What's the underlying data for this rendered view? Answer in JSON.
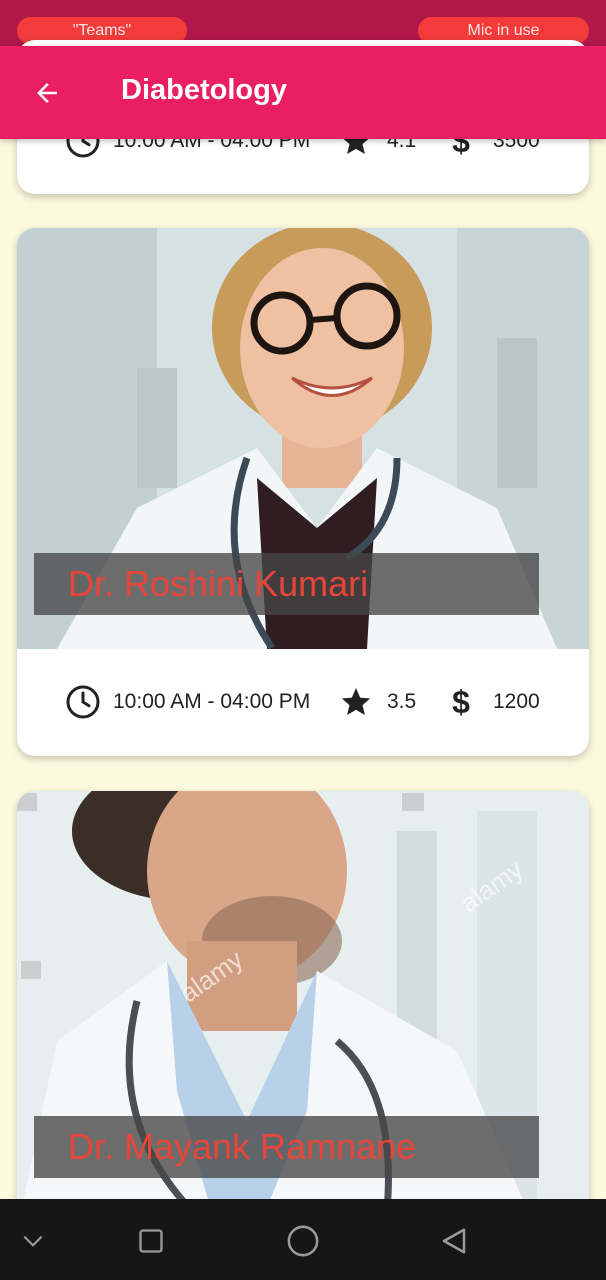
{
  "status_bar": {
    "left_pill": "\"Teams\"",
    "right_pill": "Mic in use"
  },
  "app_bar": {
    "title": "Diabetology",
    "back_icon": "arrow-left-icon"
  },
  "doctors": [
    {
      "name": "",
      "hours": "10:00 AM - 04:00 PM",
      "rating": "4.1",
      "fee": "3500"
    },
    {
      "name": "Dr. Roshini Kumari",
      "hours": "10:00 AM - 04:00 PM",
      "rating": "3.5",
      "fee": "1200"
    },
    {
      "name": "Dr. Mayank Ramnane",
      "hours": "",
      "rating": "",
      "fee": ""
    }
  ],
  "icons": {
    "hours": "clock-icon",
    "rating": "star-icon",
    "fee": "dollar-icon"
  },
  "watermark": "alamy",
  "colors": {
    "app_bar": "#e91e63",
    "status_bar": "#b0184a",
    "background": "#fdf9df",
    "name_text": "#e8453a"
  }
}
